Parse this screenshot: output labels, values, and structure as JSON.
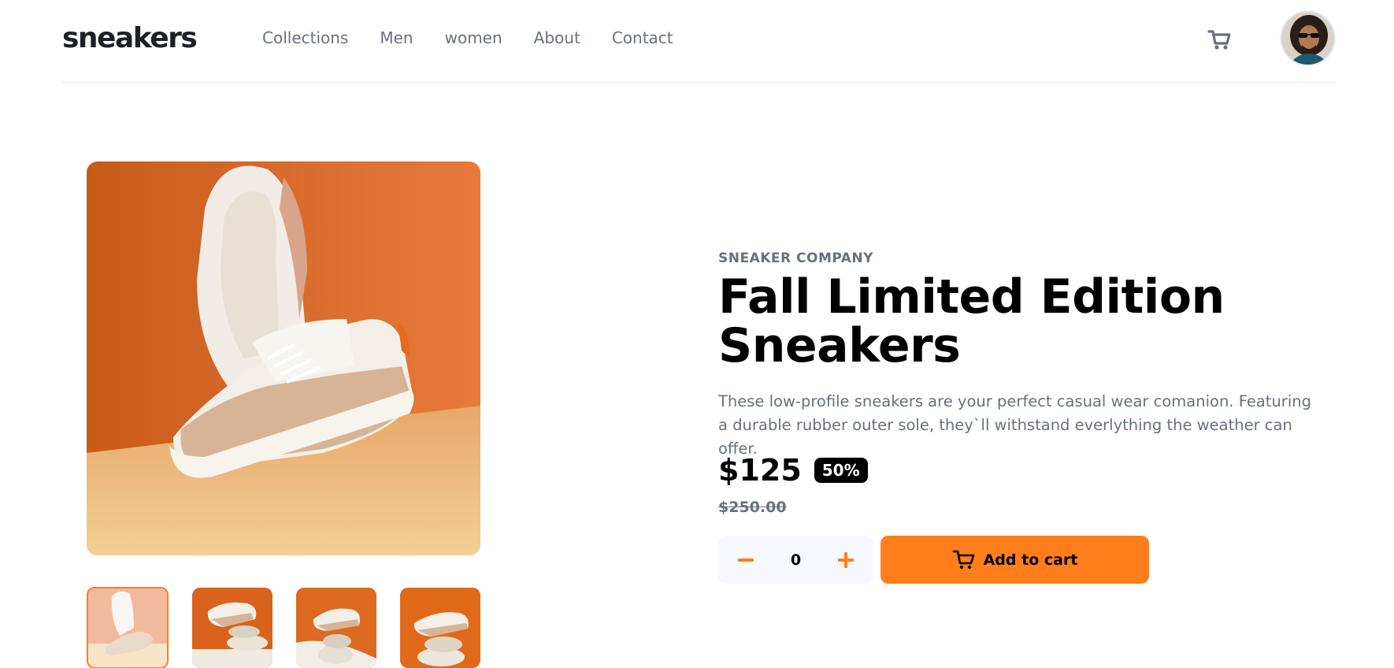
{
  "brand": {
    "logo": "sneakers"
  },
  "nav": {
    "items": [
      {
        "label": "Collections"
      },
      {
        "label": "Men"
      },
      {
        "label": "women"
      },
      {
        "label": "About"
      },
      {
        "label": "Contact"
      }
    ]
  },
  "icons": {
    "cart": "cart-icon",
    "minus": "minus-icon",
    "plus": "plus-icon",
    "avatar": "user-avatar"
  },
  "product": {
    "company": "SNEAKER COMPANY",
    "title": "Fall Limited Edition Sneakers",
    "description": "These low-profile sneakers are your perfect casual wear comanion. Featuring a durable rubber outer sole, they`ll withstand everlything the weather can offer.",
    "price": "$125",
    "discount": "50%",
    "old_price": "$250.00"
  },
  "cart": {
    "quantity": "0",
    "minus_label": "−",
    "plus_label": "+",
    "add_label": "Add to cart"
  },
  "colors": {
    "accent": "#ff7e1b",
    "text_dark": "#000000",
    "text_muted": "#68707d",
    "qty_bg": "#f6f8fd"
  }
}
